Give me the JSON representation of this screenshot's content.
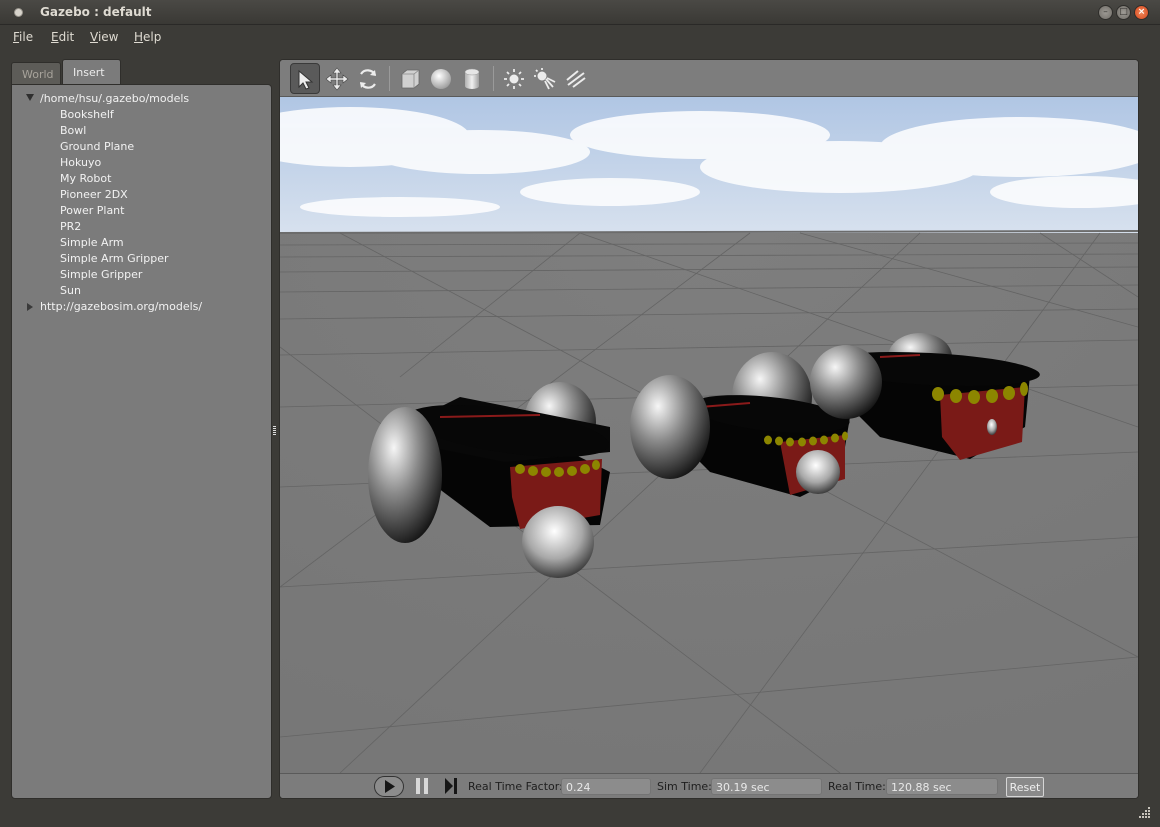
{
  "window": {
    "title": "Gazebo : default"
  },
  "menu": [
    {
      "label": "File",
      "accel": "F",
      "rest": "ile"
    },
    {
      "label": "Edit",
      "accel": "E",
      "rest": "dit"
    },
    {
      "label": "View",
      "accel": "V",
      "rest": "iew"
    },
    {
      "label": "Help",
      "accel": "H",
      "rest": "elp"
    }
  ],
  "tabs": {
    "world": "World",
    "insert": "Insert",
    "active": "Insert"
  },
  "tree": {
    "local_root": "/home/hsu/.gazebo/models",
    "local_expanded": true,
    "models": [
      "Bookshelf",
      "Bowl",
      "Ground Plane",
      "Hokuyo",
      "My Robot",
      "Pioneer 2DX",
      "Power Plant",
      "PR2",
      "Simple Arm",
      "Simple Arm Gripper",
      "Simple Gripper",
      "Sun"
    ],
    "remote_root": "http://gazebosim.org/models/",
    "remote_expanded": false
  },
  "toolbar": {
    "tools": [
      "select-arrow-icon",
      "translate-icon",
      "rotate-icon",
      "box-icon",
      "sphere-icon",
      "cylinder-icon",
      "point-light-icon",
      "spot-light-icon",
      "directional-light-icon"
    ],
    "active_tool": "select-arrow-icon"
  },
  "bottom": {
    "real_time_factor_label": "Real Time Factor:",
    "real_time_factor": "0.24",
    "sim_time_label": "Sim Time:",
    "sim_time": "30.19 sec",
    "real_time_label": "Real Time:",
    "real_time": "120.88 sec",
    "reset_label": "Reset"
  },
  "colors": {
    "sky": "#c9d8ec",
    "ground": "#7b7b7b",
    "robot_body": "#050505",
    "robot_castor": "#7a1a17",
    "robot_leds": "#8c8600",
    "close_button": "#e0552a"
  }
}
